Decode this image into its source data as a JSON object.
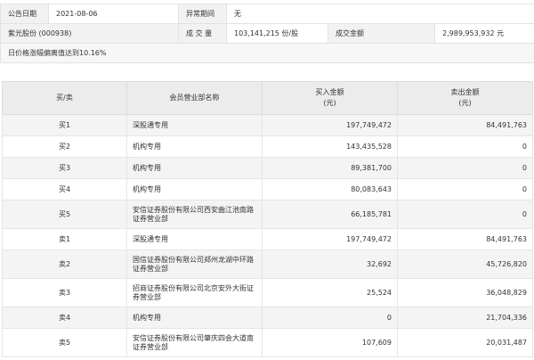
{
  "header": {
    "announce_date_label": "公告日期",
    "announce_date": "2021-08-06",
    "abnormal_period_label": "异常期间",
    "abnormal_period": "无",
    "stock_name": "紫光股份 (000938)",
    "volume_label": "成 交 量",
    "volume": "103,141,215 份/股",
    "turnover_label": "成交金额",
    "turnover": "2,989,953,932 元",
    "reason": "日价格涨幅偏离值达到10.16%"
  },
  "table": {
    "columns": [
      "买/卖",
      "会员营业部名称",
      "买入金额\n(元)",
      "卖出金额\n(元)"
    ],
    "rows": [
      {
        "side": "买1",
        "name": "深股通专用",
        "buy": "197,749,472",
        "sell": "84,491,763"
      },
      {
        "side": "买2",
        "name": "机构专用",
        "buy": "143,435,528",
        "sell": "0"
      },
      {
        "side": "买3",
        "name": "机构专用",
        "buy": "89,381,700",
        "sell": "0"
      },
      {
        "side": "买4",
        "name": "机构专用",
        "buy": "80,083,643",
        "sell": "0"
      },
      {
        "side": "买5",
        "name": "安信证券股份有限公司西安曲江池南路\n证券营业部",
        "buy": "66,185,781",
        "sell": "0"
      },
      {
        "side": "卖1",
        "name": "深股通专用",
        "buy": "197,749,472",
        "sell": "84,491,763"
      },
      {
        "side": "卖2",
        "name": "国信证券股份有限公司郑州龙湖中环路\n证券营业部",
        "buy": "32,692",
        "sell": "45,726,820"
      },
      {
        "side": "卖3",
        "name": "招商证券股份有限公司北京安外大街证\n券营业部",
        "buy": "25,524",
        "sell": "36,048,829"
      },
      {
        "side": "卖4",
        "name": "机构专用",
        "buy": "0",
        "sell": "21,704,336"
      },
      {
        "side": "卖5",
        "name": "安信证券股份有限公司肇庆四会大道南\n证券营业部",
        "buy": "107,609",
        "sell": "20,031,487"
      }
    ]
  }
}
